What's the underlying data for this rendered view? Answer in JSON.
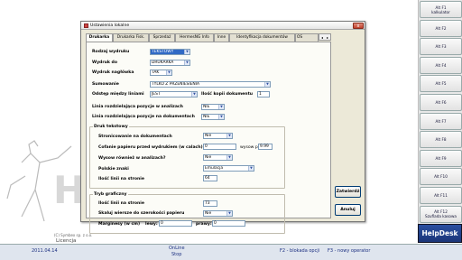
{
  "background": {
    "copyright": "(C) Symbex sp. z o.o.",
    "licencja": "Licencja"
  },
  "fkeys": [
    {
      "label": "Alt F1",
      "sub": "kalkulator"
    },
    {
      "label": "Alt F2",
      "sub": ""
    },
    {
      "label": "Alt F3",
      "sub": ""
    },
    {
      "label": "Alt F4",
      "sub": ""
    },
    {
      "label": "Alt F5",
      "sub": ""
    },
    {
      "label": "Alt F6",
      "sub": ""
    },
    {
      "label": "Alt F7",
      "sub": ""
    },
    {
      "label": "Alt F8",
      "sub": ""
    },
    {
      "label": "Alt F9",
      "sub": ""
    },
    {
      "label": "Alt F10",
      "sub": ""
    },
    {
      "label": "Alt F11",
      "sub": ""
    },
    {
      "label": "Alt F12",
      "sub": "Szuflada kasowa"
    }
  ],
  "helpdesk": "HelpDesk",
  "statusbar": {
    "date": "2011.04.14",
    "online_line1": "OnLine",
    "online_line2": "Stop",
    "f2": "F2 - blokada opcji",
    "f3": "F3 - nowy operator"
  },
  "dialog": {
    "title": "Ustawienia lokalne",
    "close": "x",
    "tabs": [
      "Drukarka",
      "Drukarka Fisk.",
      "Sprzedaż",
      "HermesNG Info",
      "Inne",
      "Identyfikacja dokumentów",
      "OS"
    ],
    "tab_scroll": [
      "◂",
      "▸"
    ],
    "fields": {
      "rodzaj_wydruku": {
        "label": "Rodzaj wydruku",
        "value": "TEKSTOWY"
      },
      "wydruk_do": {
        "label": "Wydruk do",
        "value": "DRUKARKA"
      },
      "wydruk_naglowka": {
        "label": "Wydruk nagłówka",
        "value": "TAK"
      },
      "sumowanie": {
        "label": "Sumowanie",
        "value": "TYLKO Z PRZENIESIENIA"
      },
      "odstep": {
        "label": "Odstęp między liniami",
        "value": "JEST"
      },
      "ilosc_kopii": {
        "label": "Ilość kopii dokumentu",
        "value": "1"
      },
      "linia_analizach": {
        "label": "Linia rozdzielająca pozycje w analizach",
        "value": "NIE"
      },
      "linia_dokumentach": {
        "label": "Linia rozdzielająca pozycje na dokumentach",
        "value": "NIE"
      }
    },
    "druk_tekstowy": {
      "title": "Druk tekstowy",
      "stronicowanie": {
        "label": "Stronicowanie na dokumentach",
        "value": "Nie"
      },
      "cofanie": {
        "label": "Cofanie papieru przed wydrukiem (w calach)",
        "value": "0",
        "wysow_label": "wysow po",
        "wysow_value": "9.99"
      },
      "wysow_rowniez": {
        "label": "Wysow również w analizach?",
        "value": "Nie"
      },
      "polskie_znaki": {
        "label": "Polskie znaki",
        "value": "Emulacja"
      },
      "ilosc_linii": {
        "label": "Ilość linii na stronie",
        "value": "64"
      }
    },
    "tryb_graficzny": {
      "title": "Tryb graficzny",
      "ilosc_linii": {
        "label": "Ilość linii na stronie",
        "value": "73"
      },
      "skaluj": {
        "label": "Skaluj wiersze do szerokości papieru",
        "value": "Nie"
      },
      "marginesy": {
        "label": "Marginesy (w cm)",
        "lewy_label": "lewy:",
        "lewy_value": "0",
        "prawy_label": "prawy:",
        "prawy_value": "0"
      }
    },
    "buttons": {
      "ok": "Zatwierdź",
      "cancel": "Anuluj"
    }
  }
}
